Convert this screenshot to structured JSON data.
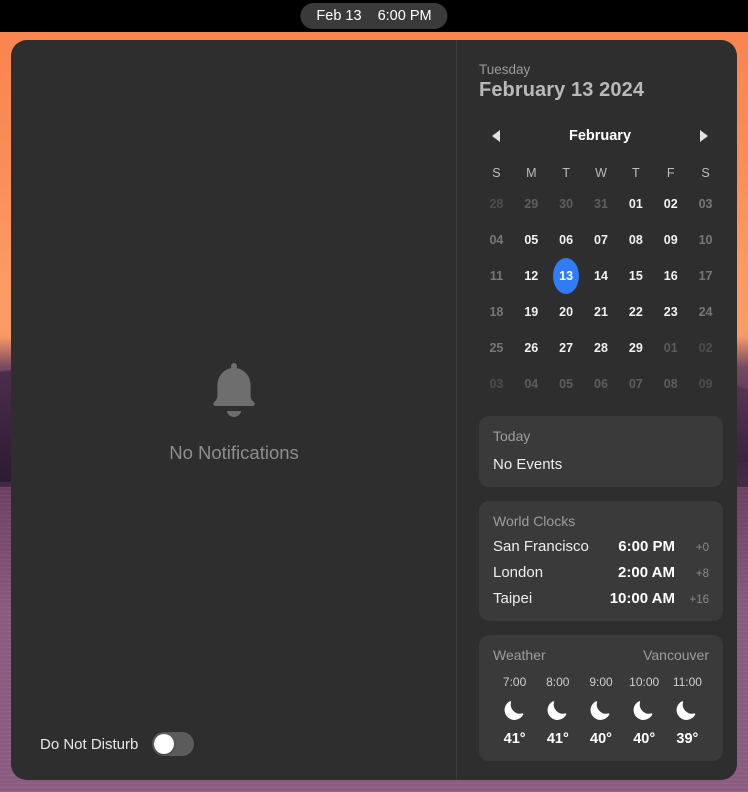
{
  "menubar": {
    "date": "Feb 13",
    "time": "6:00 PM"
  },
  "notifications": {
    "icon": "bell-icon",
    "empty_text": "No Notifications",
    "do_not_disturb": {
      "label": "Do Not Disturb",
      "state": "off"
    }
  },
  "calendar": {
    "weekday": "Tuesday",
    "full_date": "February 13 2024",
    "month_label": "February",
    "prev_icon": "chevron-left-icon",
    "next_icon": "chevron-right-icon",
    "day_headers": [
      "S",
      "M",
      "T",
      "W",
      "T",
      "F",
      "S"
    ],
    "selected_day": "13",
    "accent_color": "#2f7cf6",
    "weeks": [
      [
        {
          "n": "28",
          "month": "other",
          "weekend": true
        },
        {
          "n": "29",
          "month": "other",
          "weekend": false
        },
        {
          "n": "30",
          "month": "other",
          "weekend": false
        },
        {
          "n": "31",
          "month": "other",
          "weekend": false
        },
        {
          "n": "01",
          "month": "current",
          "weekend": false
        },
        {
          "n": "02",
          "month": "current",
          "weekend": false
        },
        {
          "n": "03",
          "month": "current",
          "weekend": true
        }
      ],
      [
        {
          "n": "04",
          "month": "current",
          "weekend": true
        },
        {
          "n": "05",
          "month": "current",
          "weekend": false
        },
        {
          "n": "06",
          "month": "current",
          "weekend": false
        },
        {
          "n": "07",
          "month": "current",
          "weekend": false
        },
        {
          "n": "08",
          "month": "current",
          "weekend": false
        },
        {
          "n": "09",
          "month": "current",
          "weekend": false
        },
        {
          "n": "10",
          "month": "current",
          "weekend": true
        }
      ],
      [
        {
          "n": "11",
          "month": "current",
          "weekend": true
        },
        {
          "n": "12",
          "month": "current",
          "weekend": false
        },
        {
          "n": "13",
          "month": "current",
          "weekend": false,
          "selected": true
        },
        {
          "n": "14",
          "month": "current",
          "weekend": false
        },
        {
          "n": "15",
          "month": "current",
          "weekend": false
        },
        {
          "n": "16",
          "month": "current",
          "weekend": false
        },
        {
          "n": "17",
          "month": "current",
          "weekend": true
        }
      ],
      [
        {
          "n": "18",
          "month": "current",
          "weekend": true
        },
        {
          "n": "19",
          "month": "current",
          "weekend": false
        },
        {
          "n": "20",
          "month": "current",
          "weekend": false
        },
        {
          "n": "21",
          "month": "current",
          "weekend": false
        },
        {
          "n": "22",
          "month": "current",
          "weekend": false
        },
        {
          "n": "23",
          "month": "current",
          "weekend": false
        },
        {
          "n": "24",
          "month": "current",
          "weekend": true
        }
      ],
      [
        {
          "n": "25",
          "month": "current",
          "weekend": true
        },
        {
          "n": "26",
          "month": "current",
          "weekend": false
        },
        {
          "n": "27",
          "month": "current",
          "weekend": false
        },
        {
          "n": "28",
          "month": "current",
          "weekend": false
        },
        {
          "n": "29",
          "month": "current",
          "weekend": false
        },
        {
          "n": "01",
          "month": "other",
          "weekend": false
        },
        {
          "n": "02",
          "month": "other",
          "weekend": true
        }
      ],
      [
        {
          "n": "03",
          "month": "other",
          "weekend": true
        },
        {
          "n": "04",
          "month": "other",
          "weekend": false
        },
        {
          "n": "05",
          "month": "other",
          "weekend": false
        },
        {
          "n": "06",
          "month": "other",
          "weekend": false
        },
        {
          "n": "07",
          "month": "other",
          "weekend": false
        },
        {
          "n": "08",
          "month": "other",
          "weekend": false
        },
        {
          "n": "09",
          "month": "other",
          "weekend": true
        }
      ]
    ]
  },
  "today_card": {
    "title": "Today",
    "body": "No Events"
  },
  "world_clocks": {
    "title": "World Clocks",
    "rows": [
      {
        "city": "San Francisco",
        "time": "6:00 PM",
        "offset": "+0"
      },
      {
        "city": "London",
        "time": "2:00 AM",
        "offset": "+8"
      },
      {
        "city": "Taipei",
        "time": "10:00 AM",
        "offset": "+16"
      }
    ]
  },
  "weather": {
    "title": "Weather",
    "location": "Vancouver",
    "hours": [
      {
        "time": "7:00",
        "icon": "moon-icon",
        "temp": "41°"
      },
      {
        "time": "8:00",
        "icon": "moon-icon",
        "temp": "41°"
      },
      {
        "time": "9:00",
        "icon": "moon-icon",
        "temp": "40°"
      },
      {
        "time": "10:00",
        "icon": "moon-icon",
        "temp": "40°"
      },
      {
        "time": "11:00",
        "icon": "moon-icon",
        "temp": "39°"
      }
    ]
  }
}
